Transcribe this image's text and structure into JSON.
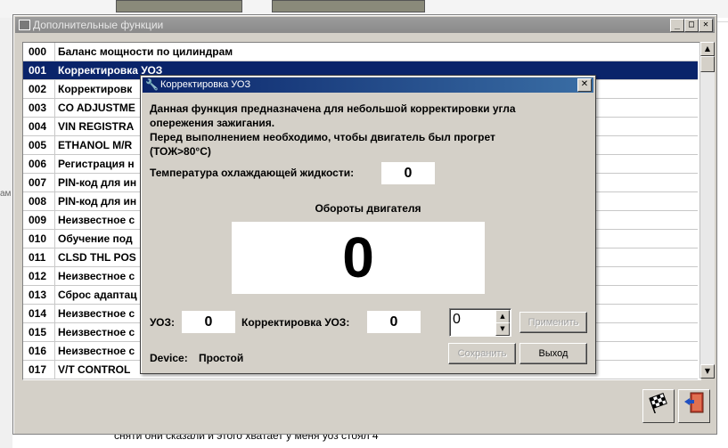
{
  "background_text": {
    "left_fragment": "ам",
    "bottom_line1": "сняти они сказали и этого хватает у меня уоз стоял 4"
  },
  "window": {
    "title": "Дополнительные функции",
    "minimize": "_",
    "maximize": "□",
    "close": "✕"
  },
  "list": {
    "selected_index": 1,
    "rows": [
      {
        "num": "000",
        "text": "Баланс мощности по цилиндрам"
      },
      {
        "num": "001",
        "text": "Корректировка УОЗ"
      },
      {
        "num": "002",
        "text": "Корректировк"
      },
      {
        "num": "003",
        "text": "CO ADJUSTME"
      },
      {
        "num": "004",
        "text": "VIN REGISTRA"
      },
      {
        "num": "005",
        "text": "ETHANOL M/R"
      },
      {
        "num": "006",
        "text": "Регистрация н"
      },
      {
        "num": "007",
        "text": "PIN-код для ин"
      },
      {
        "num": "008",
        "text": "PIN-код для ин"
      },
      {
        "num": "009",
        "text": "Неизвестное с"
      },
      {
        "num": "010",
        "text": "Обучение под"
      },
      {
        "num": "011",
        "text": "CLSD THL POS"
      },
      {
        "num": "012",
        "text": "Неизвестное с"
      },
      {
        "num": "013",
        "text": "Сброс адаптац"
      },
      {
        "num": "014",
        "text": "Неизвестное с"
      },
      {
        "num": "015",
        "text": "Неизвестное с"
      },
      {
        "num": "016",
        "text": "Неизвестное с"
      },
      {
        "num": "017",
        "text": "V/T CONTROL"
      }
    ]
  },
  "toolbar": {
    "flag_icon": "checkered-flag-icon",
    "exit_icon": "exit-door-icon"
  },
  "dialog": {
    "title": "Корректировка УОЗ",
    "close": "✕",
    "description1": "Данная функция предназначена для небольшой корректировки угла",
    "description2": "опережения зажигания.",
    "description3": "Перед выполнением необходимо, чтобы двигатель был прогрет",
    "description4": "(ТОЖ>80°С)",
    "coolant_label": "Температура охлаждающей жидкости:",
    "coolant_value": "0",
    "rpm_label": "Обороты двигателя",
    "rpm_value": "0",
    "uoz_label": "УОЗ:",
    "uoz_value": "0",
    "correction_label": "Корректировка УОЗ:",
    "correction_value": "0",
    "spinner_value": "0",
    "apply_button": "Применить",
    "save_button": "Сохранить",
    "exit_button": "Выход",
    "device_label": "Device:",
    "device_value": "Простой"
  }
}
